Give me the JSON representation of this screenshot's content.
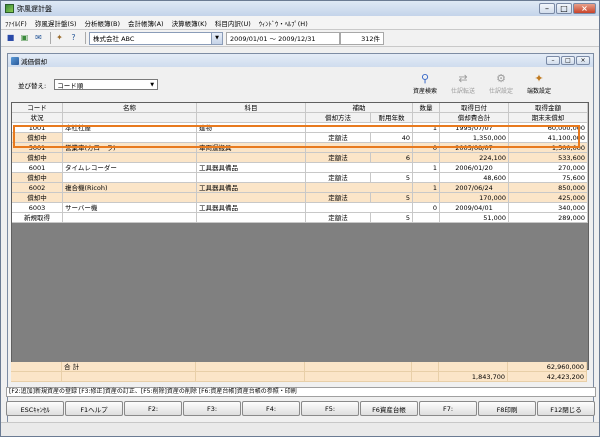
{
  "window": {
    "title": "弥風遅計盤"
  },
  "menu": [
    "ﾌｧｲﾙ(F)",
    "弥風遅計盤(S)",
    "分析帳簿(B)",
    "会計帳簿(A)",
    "決算帳簿(K)",
    "科目内訳(U)",
    "ｳｨﾝﾄﾞｳ・ﾍﾙﾌﾟ(H)"
  ],
  "toolbar": {
    "company": "株式会社 ABC",
    "period": "2009/01/01 〜 2009/12/31",
    "count": "312件"
  },
  "panel": {
    "title": "減価償却",
    "sort_label": "並び替え:",
    "sort_value": "コード順",
    "actions": [
      {
        "label": "資産検索",
        "icon": "search-icon",
        "enabled": true
      },
      {
        "label": "仕訳転送",
        "icon": "transfer-icon",
        "enabled": false
      },
      {
        "label": "仕訳設定",
        "icon": "gear-icon",
        "enabled": false
      },
      {
        "label": "端数設定",
        "icon": "tool-icon",
        "enabled": true
      }
    ]
  },
  "grid": {
    "header1": {
      "code": "コード",
      "name": "名称",
      "subject": "科目",
      "hojo": "補助",
      "qty": "数量",
      "date": "取得日付",
      "amount": "取得金額"
    },
    "header2": {
      "status": "状況",
      "method": "償却方法",
      "life": "耐用年数",
      "depr_total": "償却費合計",
      "book_value": "期末未償却"
    },
    "rows": [
      {
        "code": "1001",
        "name": "本社社屋",
        "subject": "建物",
        "qty": "1",
        "date": "1995/07/07",
        "amount": "60,000,000",
        "status": "償却中",
        "method": "定額法",
        "life": "40",
        "depr_total": "1,350,000",
        "book_value": "41,100,000"
      },
      {
        "code": "5001",
        "name": "営業車(カローラ)",
        "subject": "車両運搬具",
        "qty": "0",
        "date": "2005/08/07",
        "amount": "1,500,000",
        "status": "償却中",
        "method": "定額法",
        "life": "6",
        "depr_total": "224,100",
        "book_value": "533,600"
      },
      {
        "code": "6001",
        "name": "タイムレコーダー",
        "subject": "工具器具備品",
        "qty": "1",
        "date": "2006/01/20",
        "amount": "270,000",
        "status": "償却中",
        "method": "定額法",
        "life": "5",
        "depr_total": "48,600",
        "book_value": "75,600"
      },
      {
        "code": "6002",
        "name": "複合機(Ricoh)",
        "subject": "工具器具備品",
        "qty": "1",
        "date": "2007/06/24",
        "amount": "850,000",
        "status": "償却中",
        "method": "定額法",
        "life": "5",
        "depr_total": "170,000",
        "book_value": "425,000"
      },
      {
        "code": "6003",
        "name": "サーバー機",
        "subject": "工具器具備品",
        "qty": "0",
        "date": "2009/04/01",
        "amount": "340,000",
        "status": "新規取得",
        "method": "定額法",
        "life": "5",
        "depr_total": "51,000",
        "book_value": "289,000"
      }
    ],
    "total": {
      "label": "合 計",
      "amount": "62,960,000",
      "depr_total": "1,843,700",
      "book_value": "42,423,200"
    }
  },
  "hint": "[F2:追加]新規資産の登録 [F3:修正]資産の訂正、[F5:削除]資産の削除 [F6:資産台帳]資産台帳の参照・印刷",
  "fkeys": [
    "ESCｷｬﾝｾﾙ",
    "F1ヘルプ",
    "F2:",
    "F3:",
    "F4:",
    "F5:",
    "F6資産台帳",
    "F7:",
    "F8印刷",
    "F12閉じる"
  ]
}
